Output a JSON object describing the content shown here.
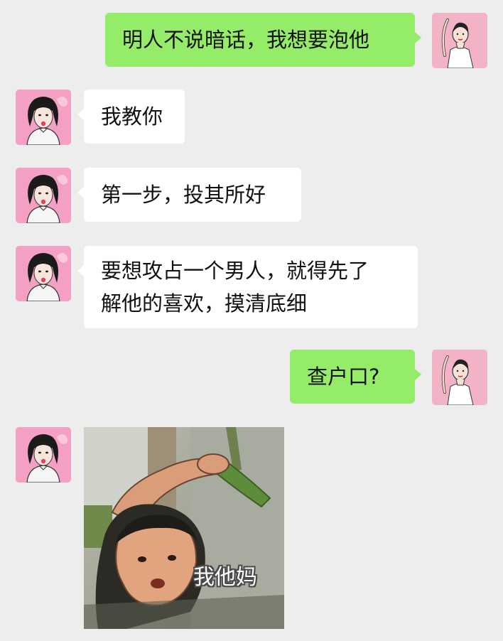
{
  "messages": [
    {
      "side": "out",
      "lines": [
        "明人不说暗话，我想要泡他"
      ]
    },
    {
      "side": "in",
      "lines": [
        "我教你"
      ]
    },
    {
      "side": "in",
      "lines": [
        "第一步，投其所好"
      ]
    },
    {
      "side": "in",
      "lines": [
        "要想攻占一个男人，就得先了",
        "解他的喜欢，摸清底细"
      ]
    },
    {
      "side": "out",
      "lines": [
        "查户口?"
      ]
    },
    {
      "side": "in",
      "type": "sticker",
      "caption": "我他妈"
    }
  ],
  "colors": {
    "background": "#ededed",
    "outgoing_bubble": "#95ec69",
    "incoming_bubble": "#ffffff",
    "avatar_bg": "#f4a0c4"
  },
  "icons": {
    "incoming_avatar": "girl-bubblegum-avatar",
    "outgoing_avatar": "woman-raised-arm-avatar"
  }
}
